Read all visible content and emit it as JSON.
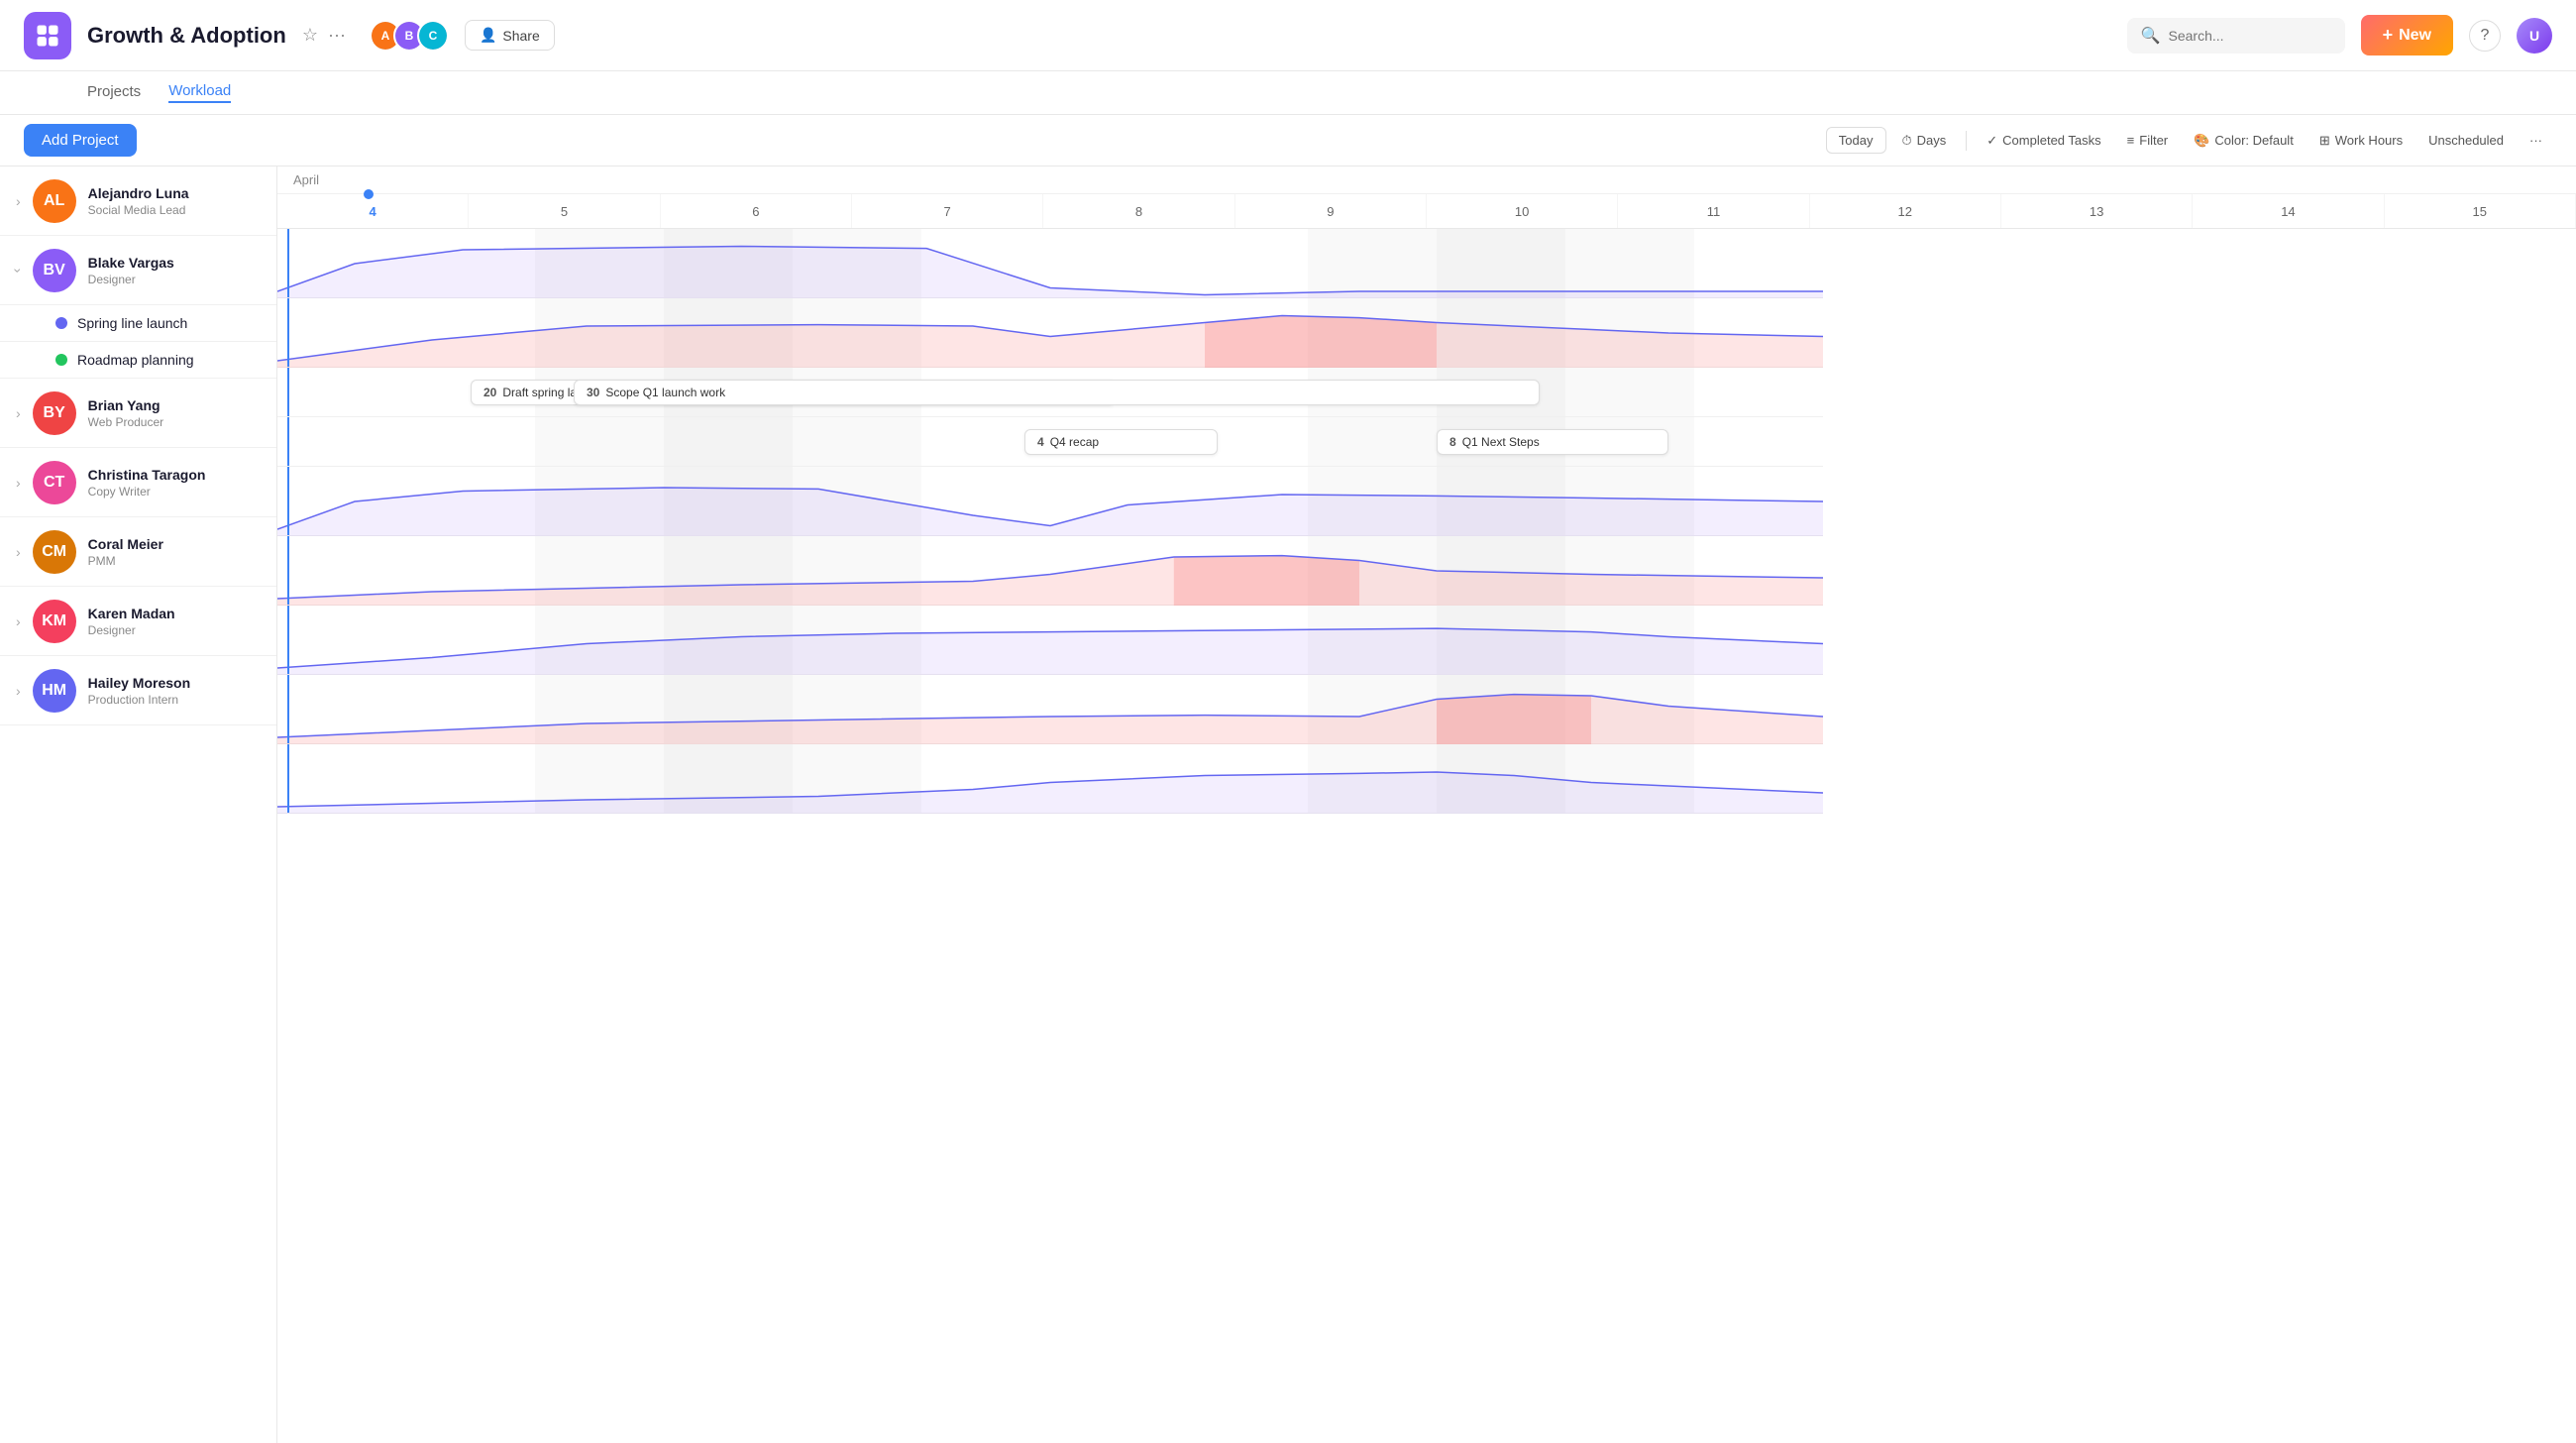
{
  "app": {
    "title": "Growth & Adoption",
    "logo_bg": "#8b5cf6"
  },
  "nav": {
    "tabs": [
      {
        "id": "projects",
        "label": "Projects"
      },
      {
        "id": "workload",
        "label": "Workload",
        "active": true
      }
    ]
  },
  "header": {
    "share_label": "Share",
    "search_placeholder": "Search...",
    "new_label": "New",
    "help_label": "?",
    "avatars": [
      {
        "color": "#f97316",
        "initials": "A"
      },
      {
        "color": "#8b5cf6",
        "initials": "B"
      },
      {
        "color": "#06b6d4",
        "initials": "C"
      }
    ]
  },
  "toolbar": {
    "add_project_label": "Add Project",
    "today_label": "Today",
    "days_label": "Days",
    "completed_tasks_label": "Completed Tasks",
    "filter_label": "Filter",
    "color_label": "Color: Default",
    "work_hours_label": "Work Hours",
    "unscheduled_label": "Unscheduled",
    "more_label": "..."
  },
  "gantt": {
    "month": "April",
    "days": [
      4,
      5,
      6,
      7,
      8,
      9,
      10,
      11,
      12,
      13,
      14,
      15
    ],
    "today_col": 0
  },
  "people": [
    {
      "name": "Alejandro Luna",
      "role": "Social Media Lead",
      "color": "#f97316",
      "initials": "AL",
      "expanded": false
    },
    {
      "name": "Blake Vargas",
      "role": "Designer",
      "color": "#8b5cf6",
      "initials": "BV",
      "expanded": true,
      "projects": [
        {
          "name": "Spring line launch",
          "dot_color": "#6366f1"
        },
        {
          "name": "Roadmap planning",
          "dot_color": "#22c55e"
        }
      ]
    },
    {
      "name": "Brian Yang",
      "role": "Web Producer",
      "color": "#ef4444",
      "initials": "BY",
      "expanded": false
    },
    {
      "name": "Christina Taragon",
      "role": "Copy Writer",
      "color": "#ec4899",
      "initials": "CT",
      "expanded": false
    },
    {
      "name": "Coral Meier",
      "role": "PMM",
      "color": "#d97706",
      "initials": "CM",
      "expanded": false
    },
    {
      "name": "Karen Madan",
      "role": "Designer",
      "color": "#f43f5e",
      "initials": "KM",
      "expanded": false
    },
    {
      "name": "Hailey Moreson",
      "role": "Production Intern",
      "color": "#6366f1",
      "initials": "HM",
      "expanded": false
    }
  ],
  "tasks": [
    {
      "num": 20,
      "label": "Draft spring launch spec",
      "col_start": 2,
      "col_end": 7
    },
    {
      "num": 30,
      "label": "Scope Q1 launch work",
      "col_start": 3,
      "col_end": 10
    },
    {
      "num": 4,
      "label": "Q4 recap",
      "col_start": 6,
      "col_end": 7
    },
    {
      "num": 8,
      "label": "Q1 Next Steps",
      "col_start": 9,
      "col_end": 10
    }
  ]
}
